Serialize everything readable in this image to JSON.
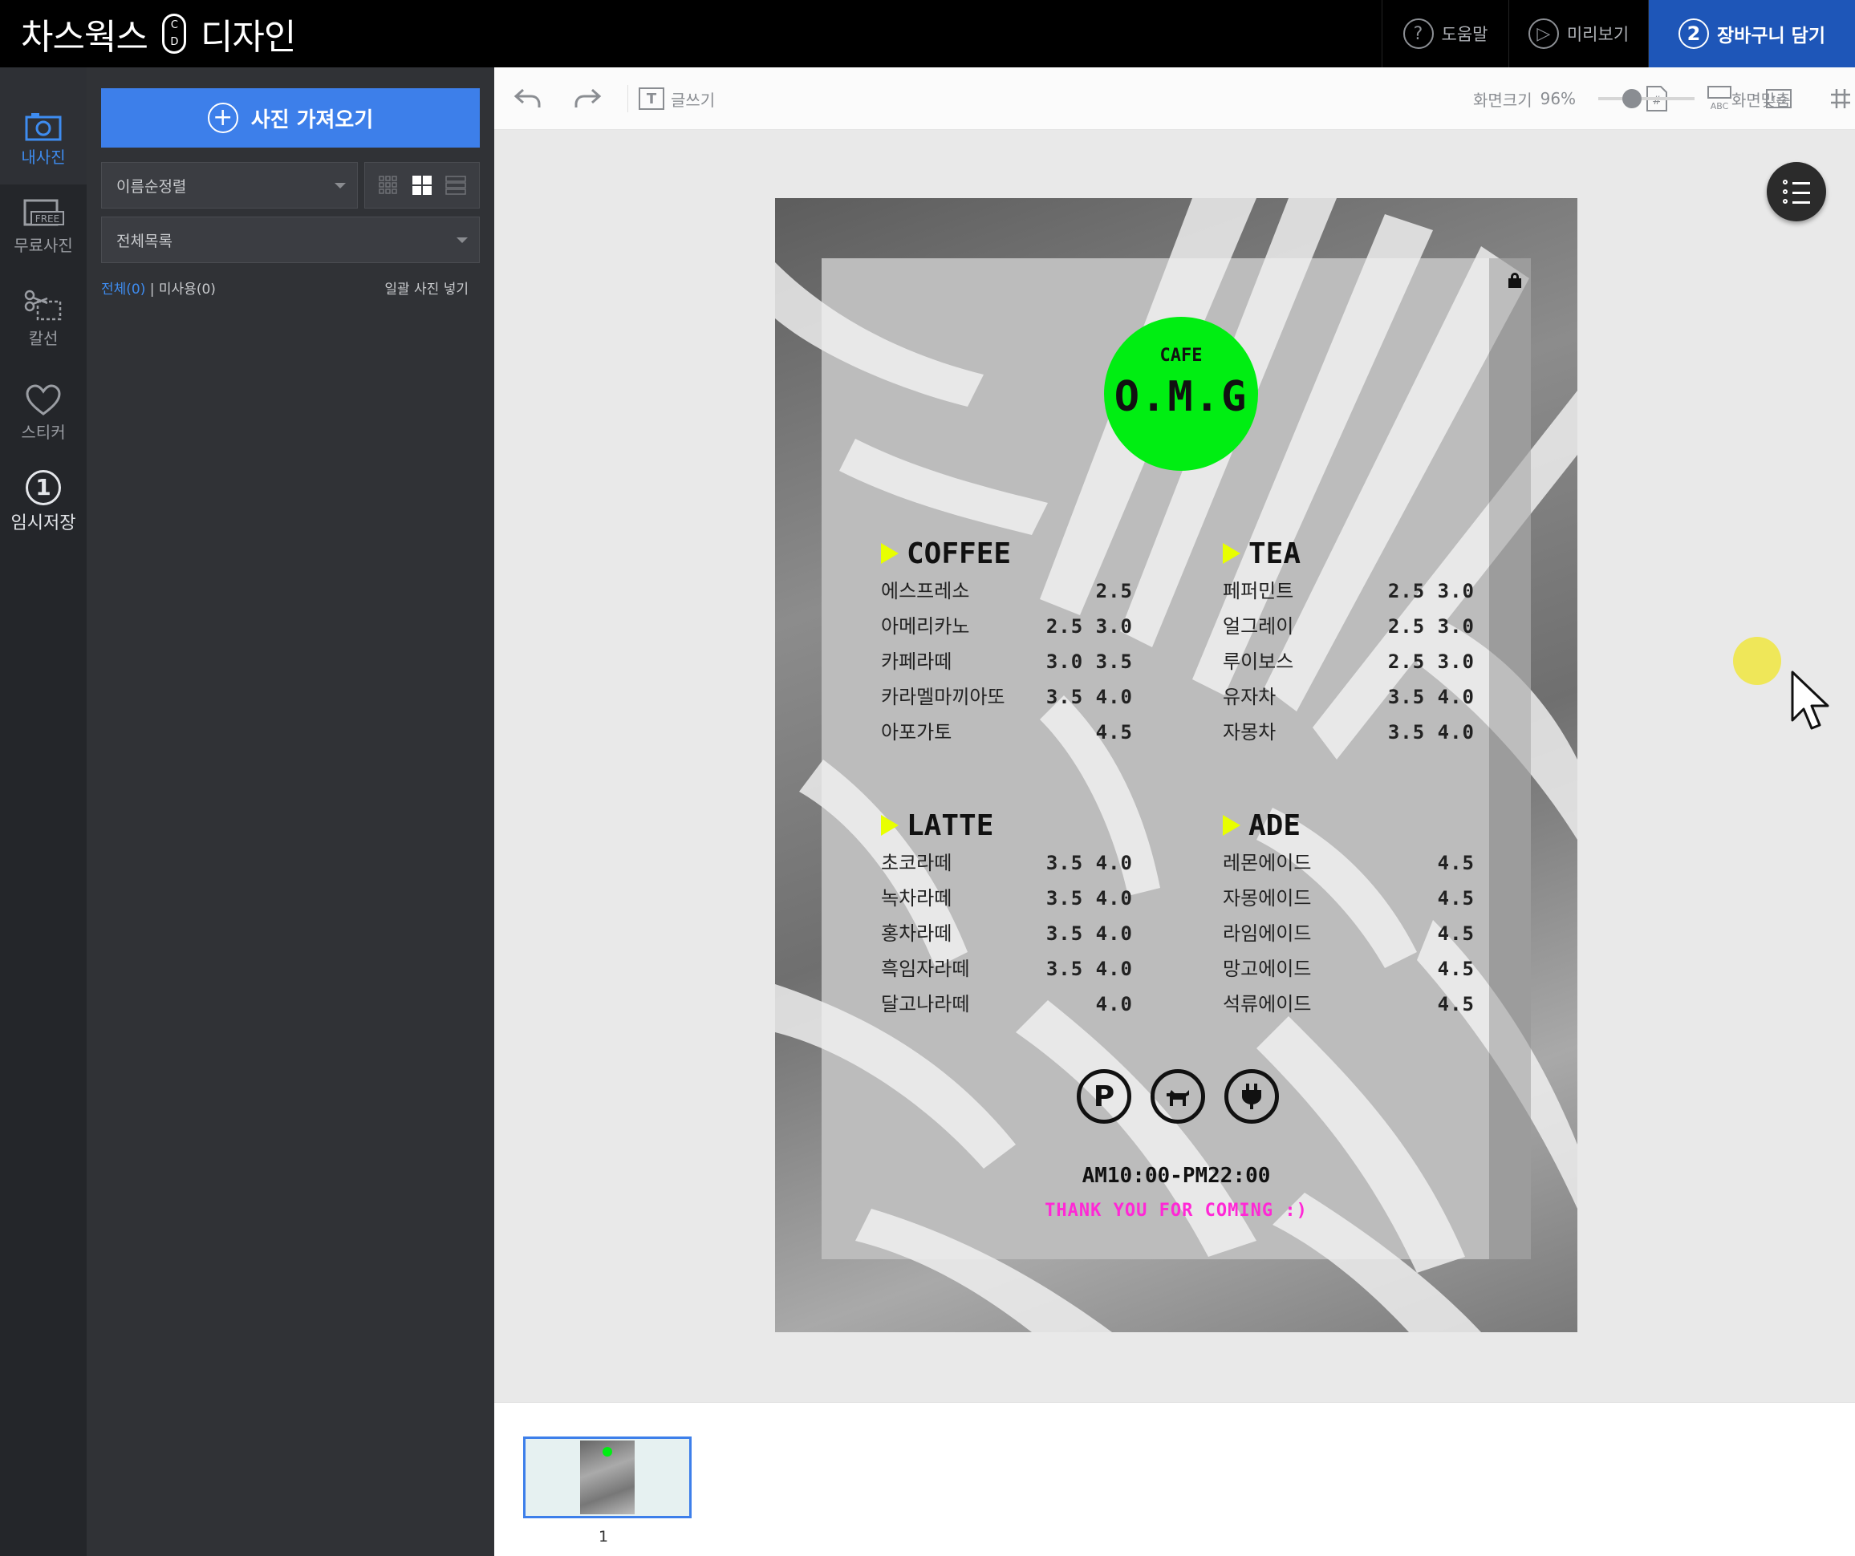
{
  "app": {
    "brand_left": "차스웍스",
    "brand_right": "디자인",
    "logo_c": "C",
    "logo_d": "D"
  },
  "topbar": {
    "help_label": "도움말",
    "help_icon": "?",
    "preview_label": "미리보기",
    "preview_icon": "▷",
    "cart_label": "장바구니 담기",
    "cart_step": "2",
    "cart_color": "#1e56b8"
  },
  "rail": {
    "items": [
      {
        "label": "내사진",
        "icon": "camera-icon"
      },
      {
        "label": "무료사진",
        "icon": "free-photo-icon"
      },
      {
        "label": "칼선",
        "icon": "scissors-icon"
      },
      {
        "label": "스티커",
        "icon": "heart-icon"
      },
      {
        "label": "임시저장",
        "icon": "temp-save-icon",
        "number": "1"
      }
    ]
  },
  "panel": {
    "import_label": "사진 가져오기",
    "sort_value": "이름순정렬",
    "list_value": "전체목록",
    "filter_all": "전체(0)",
    "filter_sep": "|",
    "filter_unused": "미사용(0)",
    "bulk_insert": "일괄 사진 넣기"
  },
  "toolbar": {
    "text_label": "글쓰기",
    "text_icon": "T",
    "page_icon": "#",
    "abc_label": "ABC",
    "num_label": "123",
    "zoom_label": "화면크기",
    "zoom_value": "96%",
    "zoom_level": 0.35,
    "fit_label": "화면맞춤"
  },
  "poster": {
    "cafe": "CAFE",
    "name": "O.M.G",
    "accent": "#00ee12",
    "highlight": "#e8ff00",
    "sections": [
      {
        "title": "COFFEE",
        "items": [
          {
            "name": "에스프레소",
            "price": "2.5"
          },
          {
            "name": "아메리카노",
            "price": "2.5 3.0"
          },
          {
            "name": "카페라떼",
            "price": "3.0 3.5"
          },
          {
            "name": "카라멜마끼아또",
            "price": "3.5 4.0"
          },
          {
            "name": "아포가토",
            "price": "4.5"
          }
        ]
      },
      {
        "title": "TEA",
        "items": [
          {
            "name": "페퍼민트",
            "price": "2.5 3.0"
          },
          {
            "name": "얼그레이",
            "price": "2.5 3.0"
          },
          {
            "name": "루이보스",
            "price": "2.5 3.0"
          },
          {
            "name": "유자차",
            "price": "3.5 4.0"
          },
          {
            "name": "자몽차",
            "price": "3.5 4.0"
          }
        ]
      },
      {
        "title": "LATTE",
        "items": [
          {
            "name": "초코라떼",
            "price": "3.5 4.0"
          },
          {
            "name": "녹차라떼",
            "price": "3.5 4.0"
          },
          {
            "name": "홍차라떼",
            "price": "3.5 4.0"
          },
          {
            "name": "흑임자라떼",
            "price": "3.5 4.0"
          },
          {
            "name": "달고나라떼",
            "price": "4.0"
          }
        ]
      },
      {
        "title": "ADE",
        "items": [
          {
            "name": "레몬에이드",
            "price": "4.5"
          },
          {
            "name": "자몽에이드",
            "price": "4.5"
          },
          {
            "name": "라임에이드",
            "price": "4.5"
          },
          {
            "name": "망고에이드",
            "price": "4.5"
          },
          {
            "name": "석류에이드",
            "price": "4.5"
          }
        ]
      }
    ],
    "amenities": [
      {
        "icon": "parking-icon",
        "glyph": "P"
      },
      {
        "icon": "pet-icon",
        "glyph": "🐕"
      },
      {
        "icon": "plug-icon",
        "glyph": "⏻"
      }
    ],
    "hours": "AM10:00-PM22:00",
    "thanks": "THANK YOU FOR COMING :)",
    "thanks_color": "#ff28d6"
  },
  "pages": {
    "thumb_number": "1"
  }
}
